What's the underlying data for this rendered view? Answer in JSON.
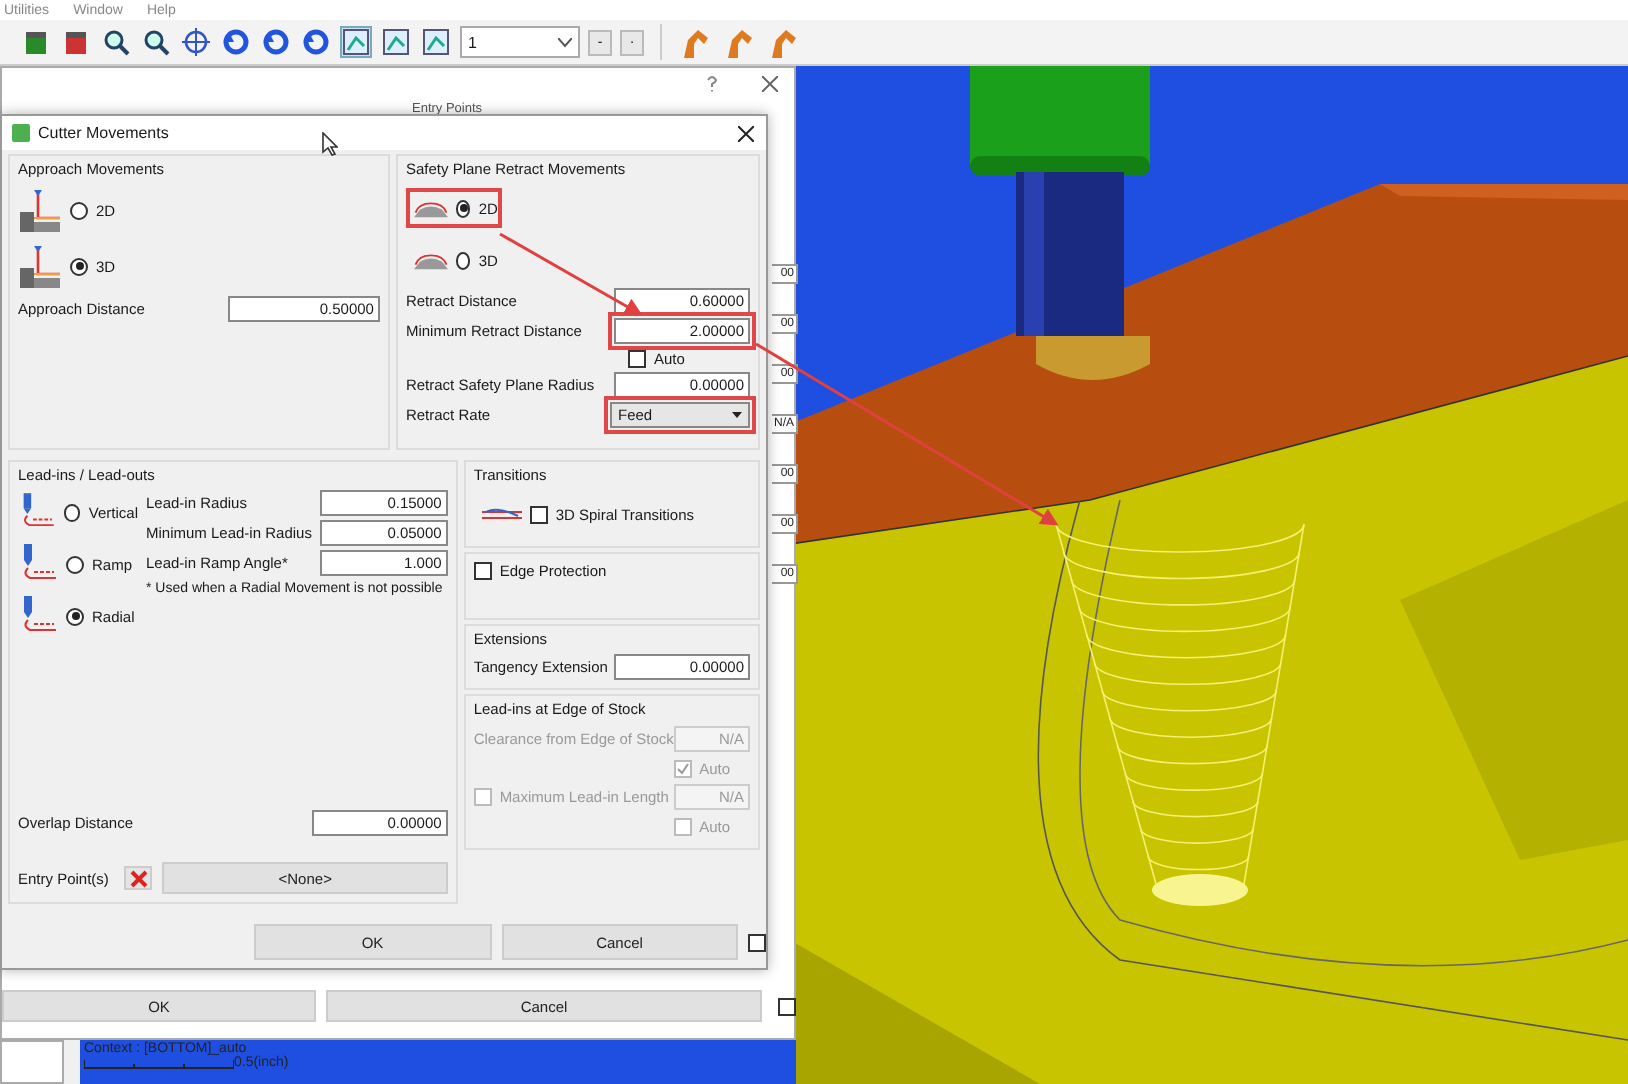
{
  "menu": [
    {
      "label": "Utilities"
    },
    {
      "label": "Window"
    },
    {
      "label": "Help"
    }
  ],
  "toolbar": {
    "layer": "1",
    "step_buttons": [
      "-",
      "·"
    ]
  },
  "back_dialog": {
    "heading": "Entry Points",
    "side_values": [
      "00",
      "00",
      "00",
      "N/A",
      "00",
      "00",
      "00"
    ],
    "ok": "OK",
    "cancel": "Cancel",
    "option_checked": false
  },
  "dialog": {
    "title": "Cutter Movements",
    "approach": {
      "title": "Approach Movements",
      "options": [
        {
          "label": "2D",
          "selected": false
        },
        {
          "label": "3D",
          "selected": true
        }
      ],
      "distance_label": "Approach Distance",
      "distance": "0.50000"
    },
    "retract": {
      "title": "Safety Plane Retract Movements",
      "options": [
        {
          "label": "2D",
          "selected": true,
          "highlighted": true
        },
        {
          "label": "3D",
          "selected": false,
          "highlighted": false
        }
      ],
      "fields": [
        {
          "label": "Retract Distance",
          "value": "0.60000",
          "highlighted": false
        },
        {
          "label": "Minimum Retract Distance",
          "value": "2.00000",
          "highlighted": true
        }
      ],
      "auto": {
        "label": "Auto",
        "checked": false
      },
      "radius_label": "Retract Safety Plane Radius",
      "radius": "0.00000",
      "rate_label": "Retract Rate",
      "rate": "Feed",
      "rate_highlighted": true
    },
    "leadins": {
      "title": "Lead-ins / Lead-outs",
      "options": [
        {
          "label": "Vertical",
          "selected": false
        },
        {
          "label": "Ramp",
          "selected": false
        },
        {
          "label": "Radial",
          "selected": true
        }
      ],
      "fields": [
        {
          "label": "Lead-in Radius",
          "value": "0.15000"
        },
        {
          "label": "Minimum Lead-in Radius",
          "value": "0.05000"
        },
        {
          "label": "Lead-in Ramp Angle*",
          "value": "1.000"
        }
      ],
      "note": "* Used when a Radial Movement is not possible",
      "overlap_label": "Overlap Distance",
      "overlap": "0.00000",
      "entry_label": "Entry Point(s)",
      "entry_value": "<None>"
    },
    "transitions": {
      "title": "Transitions",
      "spiral": {
        "label": "3D Spiral Transitions",
        "checked": false
      }
    },
    "edge_protection": {
      "label": "Edge Protection",
      "checked": false
    },
    "extensions": {
      "title": "Extensions",
      "label": "Tangency Extension",
      "value": "0.00000"
    },
    "stock_edge": {
      "title": "Lead-ins at Edge of Stock",
      "disabled": true,
      "rows": [
        {
          "kind": "field",
          "label": "Clearance from Edge of Stock",
          "value": "N/A"
        },
        {
          "kind": "check",
          "label": "Auto",
          "checked": true
        },
        {
          "kind": "checkfield",
          "label": "Maximum Lead-in Length",
          "checked": false,
          "value": "N/A"
        },
        {
          "kind": "check",
          "label": "Auto",
          "checked": false
        }
      ]
    },
    "ok": "OK",
    "cancel": "Cancel",
    "option_checked": false
  },
  "viewport": {
    "context": "Context : [BOTTOM]_auto",
    "scale": "0.5(inch)"
  }
}
